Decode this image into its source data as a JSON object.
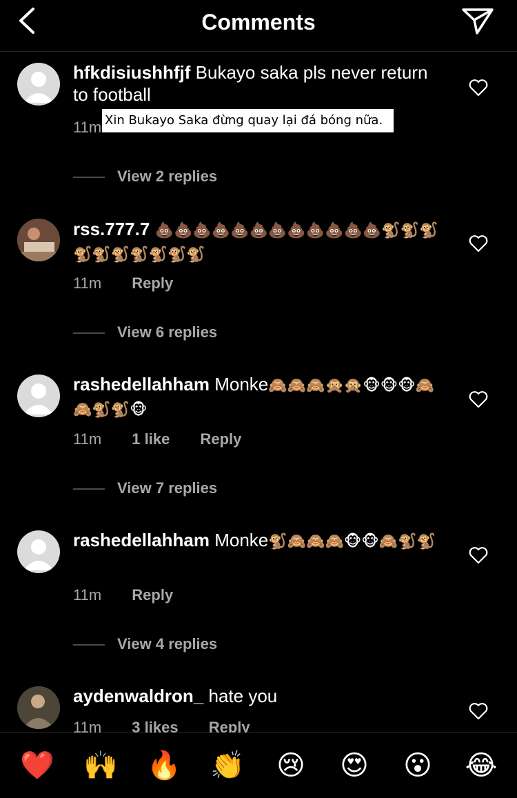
{
  "header": {
    "title": "Comments"
  },
  "comments": [
    {
      "username": "hfkdisiushhfjf",
      "text": "Bukayo saka pls never return to football",
      "time": "11m",
      "replies": "View 2 replies",
      "translation": "Xin Bukayo Saka đừng quay lại đá bóng nữa."
    },
    {
      "username": "rss.777.7",
      "text": "",
      "emojis": "💩💩💩💩💩💩💩💩💩💩💩💩🐒🐒🐒🐒🐒🐒🐒🐒🐒🐒",
      "time": "11m",
      "reply": "Reply",
      "replies": "View 6 replies"
    },
    {
      "username": "rashedellahham",
      "text": "Monke",
      "emojis": "🙈🙈🙈🙊🙊🐵🐵🐵🙈🙈🐒🐒🐵",
      "time": "11m",
      "likes": "1 like",
      "reply": "Reply",
      "replies": "View 7 replies"
    },
    {
      "username": "rashedellahham",
      "text": "Monke",
      "emojis": "🐒🙈🙈🙈🐵🐵🙈🐒🐒",
      "time": "11m",
      "reply": "Reply",
      "replies": "View 4 replies"
    },
    {
      "username": "aydenwaldron_",
      "text": "hate you",
      "time": "11m",
      "likes": "3 likes",
      "reply": "Reply"
    }
  ],
  "emoji_bar": [
    "❤️",
    "🙌",
    "🔥",
    "👏",
    "😢",
    "😍",
    "😮",
    "😂"
  ]
}
